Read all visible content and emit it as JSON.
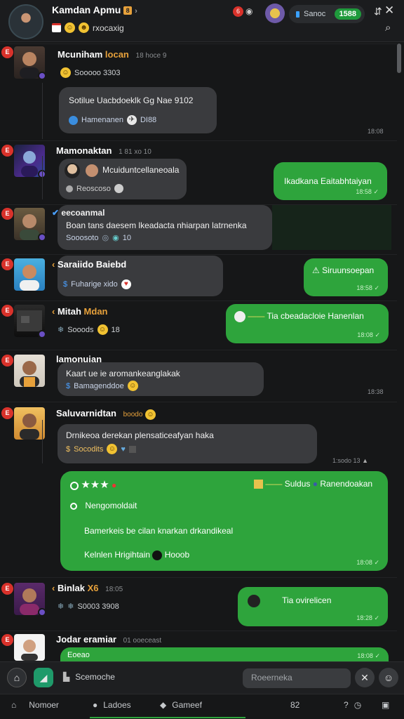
{
  "header": {
    "title": "Kamdan Apmu",
    "title_badge": "8",
    "subtitle": "rxocaxig",
    "notif_count": "6",
    "pill_label": "Sanoc",
    "pill_count": "1588"
  },
  "messages": [
    {
      "name": "Mcuniham",
      "name_alt": "locan",
      "meta": "18 hoce 9",
      "sub": "Sooooo 3303",
      "bubble_text": "Sotilue Uacbdoeklk Gg Nae 9102",
      "bubble_sub": "Hamenanen",
      "bubble_sub2": "DI88",
      "stamp": "18:08"
    },
    {
      "name": "Mamonaktan",
      "meta": "1 81 xo 10",
      "bubble_text": "Mcuiduntcellaneoala",
      "bubble_sub": "Reoscoso",
      "out_text": "Ikadkana Eaitabhtaiyan",
      "out_stamp": "18:58"
    },
    {
      "name": "eecoanmal",
      "bubble_text": "Boan tans daesem lkeadacta nhiarpan latrnenka",
      "bubble_sub": "Sooosoto",
      "bubble_sub2": "10"
    },
    {
      "name": "Saraiido Baiebd",
      "sub": "Fuharige xido",
      "out_text": "Siruunsoepan",
      "out_stamp": "18:58"
    },
    {
      "name": "Mitah",
      "name_alt": "Mdan",
      "sub": "Sooods",
      "sub2": "18",
      "out_text": "Tia cbeadacloie Hanenlan",
      "out_stamp": "18:08"
    },
    {
      "name": "lamonuian",
      "bubble_text": "Kaart ue ie aromankeanglakak",
      "bubble_sub": "Bamagenddoe",
      "stamp": "18:38"
    },
    {
      "name": "Saluvarnidtan",
      "meta": "boodo",
      "bubble_text": "Drnikeoa derekan plensaticeafyan haka",
      "bubble_sub": "Socodits",
      "stamp": "1:sodo 13"
    },
    {
      "out_card": {
        "title_rating": "★★★",
        "title_right": "Suldus",
        "title_right2": "Ranendoakan",
        "line1": "Nengomoldait",
        "line2": "Bamerkeis be cilan knarkan drkandikeal",
        "line3": "Kelnlen Hrigihtain",
        "line3b": "Hooob",
        "stamp": "18:08"
      }
    },
    {
      "name": "Binlak",
      "name_alt": "X6",
      "meta": "18:05",
      "sub": "S0003 3908",
      "out_text": "Tia ovirelicen",
      "out_stamp": "18:28"
    },
    {
      "name": "Jodar eramiar",
      "meta": "01 ooeceast",
      "out_text": "Eoeao",
      "out_stamp": "18:08"
    }
  ],
  "composer": {
    "label": "Scemoche",
    "placeholder": "Roeerneka"
  },
  "bottom_nav": [
    {
      "label": "Nomoer",
      "icon": "home-icon"
    },
    {
      "label": "Ladoes",
      "icon": "person-icon"
    },
    {
      "label": "Gameef",
      "icon": "chat-icon"
    },
    {
      "label": "82",
      "icon": "counter-icon"
    }
  ],
  "colors": {
    "accent_green": "#2ea43c",
    "badge_red": "#d9322b",
    "background": "#161718",
    "bubble_in": "#3a3b3e"
  }
}
